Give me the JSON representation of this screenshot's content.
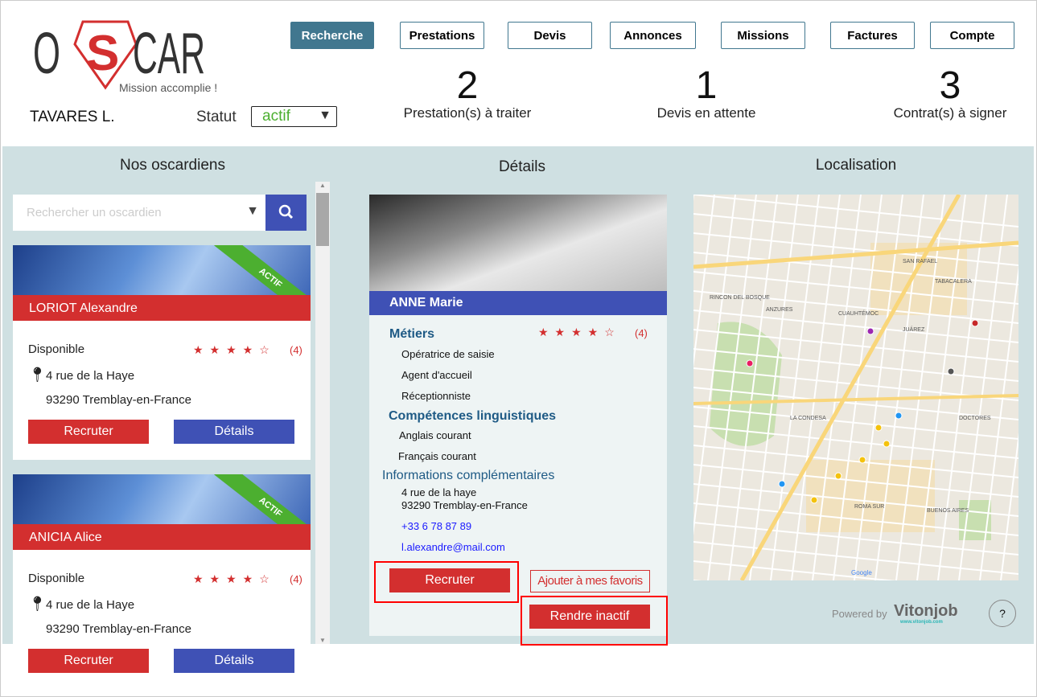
{
  "logo": {
    "text": "OSCAR",
    "tagline": "Mission accomplie !"
  },
  "nav": [
    {
      "label": "Recherche",
      "active": true
    },
    {
      "label": "Prestations"
    },
    {
      "label": "Devis"
    },
    {
      "label": "Annonces"
    },
    {
      "label": "Missions"
    },
    {
      "label": "Factures"
    },
    {
      "label": "Compte"
    }
  ],
  "user": {
    "name": "TAVARES L.",
    "status_label": "Statut",
    "status_value": "actif"
  },
  "stats": [
    {
      "value": "2",
      "label": "Prestation(s) à traiter"
    },
    {
      "value": "1",
      "label": "Devis en attente"
    },
    {
      "value": "3",
      "label": "Contrat(s) à signer"
    }
  ],
  "left": {
    "title": "Nos oscardiens",
    "search_placeholder": "Rechercher un oscardien",
    "cards": [
      {
        "name": "LORIOT Alexandre",
        "badge": "ACTIF",
        "availability": "Disponible",
        "rating": 4,
        "rating_count": "(4)",
        "address1": "4 rue de la Haye",
        "address2": "93290 Tremblay-en-France",
        "recruit": "Recruter",
        "details": "Détails"
      },
      {
        "name": "ANICIA Alice",
        "badge": "ACTIF",
        "availability": "Disponible",
        "rating": 4,
        "rating_count": "(4)",
        "address1": "4 rue de la Haye",
        "address2": "93290 Tremblay-en-France",
        "recruit": "Recruter",
        "details": "Détails"
      }
    ]
  },
  "details": {
    "title": "Détails",
    "name": "ANNE Marie",
    "rating": 4,
    "rating_count": "(4)",
    "jobs_title": "Métiers",
    "jobs": [
      "Opératrice de saisie",
      "Agent d'accueil",
      "Réceptionniste"
    ],
    "lang_title": "Compétences linguistiques",
    "langs": [
      "Anglais courant",
      "Français courant"
    ],
    "info_title": "Informations complémentaires",
    "address1": "4 rue de la haye",
    "address2": "93290 Tremblay-en-France",
    "phone": "+33 6 78 87 89",
    "email": "l.alexandre@mail.com",
    "recruit": "Recruter",
    "favorite": "Ajouter à mes favoris",
    "deactivate": "Rendre inactif"
  },
  "map": {
    "title": "Localisation",
    "labels": [
      "SAN RAFAEL",
      "TABACALERA",
      "ANZURES",
      "CUAUHTÉMOC",
      "JUÁREZ",
      "DOCTORES",
      "LA CONDESA",
      "ROMA SUR",
      "BUENOS AIRES",
      "RINCON DEL BOSQUE"
    ],
    "provider": "Google"
  },
  "footer": {
    "powered_by": "Powered by",
    "brand": "Vitonjob",
    "brand_url": "www.vitonjob.com",
    "help": "?"
  },
  "colors": {
    "accent": "#41778f",
    "red": "#d32f2f",
    "blue": "#3f51b5",
    "green": "#4caf30"
  }
}
